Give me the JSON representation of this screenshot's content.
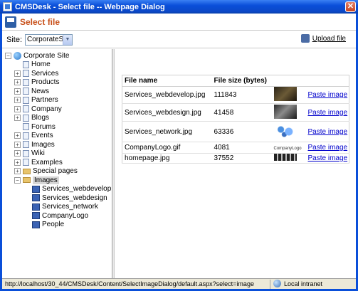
{
  "window": {
    "title": "CMSDesk - Select file -- Webpage Dialog",
    "close_label": "✕"
  },
  "header": {
    "title": "Select file"
  },
  "toolbar": {
    "site_label": "Site:",
    "site_value": "CorporateSite",
    "upload_label": "Upload file"
  },
  "tree": {
    "root": "Corporate Site",
    "items": [
      {
        "label": "Home",
        "kind": "page",
        "expander": false,
        "indent": 1
      },
      {
        "label": "Services",
        "kind": "page",
        "expander": true,
        "indent": 1
      },
      {
        "label": "Products",
        "kind": "page",
        "expander": true,
        "indent": 1
      },
      {
        "label": "News",
        "kind": "page",
        "expander": true,
        "indent": 1
      },
      {
        "label": "Partners",
        "kind": "page",
        "expander": true,
        "indent": 1
      },
      {
        "label": "Company",
        "kind": "page",
        "expander": true,
        "indent": 1
      },
      {
        "label": "Blogs",
        "kind": "page",
        "expander": true,
        "indent": 1
      },
      {
        "label": "Forums",
        "kind": "page",
        "expander": false,
        "indent": 1
      },
      {
        "label": "Events",
        "kind": "page",
        "expander": true,
        "indent": 1
      },
      {
        "label": "Images",
        "kind": "page",
        "expander": true,
        "indent": 1
      },
      {
        "label": "Wiki",
        "kind": "page",
        "expander": true,
        "indent": 1
      },
      {
        "label": "Examples",
        "kind": "page",
        "expander": true,
        "indent": 1
      },
      {
        "label": "Special pages",
        "kind": "folder",
        "expander": true,
        "indent": 1
      },
      {
        "label": "Images",
        "kind": "folder",
        "expander": "minus",
        "indent": 1,
        "selected": true
      },
      {
        "label": "Services_webdevelop",
        "kind": "image",
        "expander": false,
        "indent": 2
      },
      {
        "label": "Services_webdesign",
        "kind": "image",
        "expander": false,
        "indent": 2
      },
      {
        "label": "Services_network",
        "kind": "image",
        "expander": false,
        "indent": 2
      },
      {
        "label": "CompanyLogo",
        "kind": "image",
        "expander": false,
        "indent": 2
      },
      {
        "label": "People",
        "kind": "image",
        "expander": false,
        "indent": 2
      }
    ]
  },
  "files": {
    "columns": [
      "File name",
      "File size (bytes)",
      "",
      ""
    ],
    "rows": [
      {
        "name": "Services_webdevelop.jpg",
        "size": "111843",
        "action": "Paste image",
        "thumb": "dark-photo"
      },
      {
        "name": "Services_webdesign.jpg",
        "size": "41458",
        "action": "Paste image",
        "thumb": "dark-photo-2"
      },
      {
        "name": "Services_network.jpg",
        "size": "63336",
        "action": "Paste image",
        "thumb": "network"
      },
      {
        "name": "CompanyLogo.gif",
        "size": "4081",
        "action": "Paste image",
        "thumb": "logo"
      },
      {
        "name": "homepage.jpg",
        "size": "37552",
        "action": "Paste image",
        "thumb": "people"
      }
    ]
  },
  "status": {
    "url": "http://localhost/30_44/CMSDesk/Content/SelectImageDialog/default.aspx?select=image",
    "zone": "Local intranet"
  },
  "thumb_logo_text": "CompanyLogo"
}
